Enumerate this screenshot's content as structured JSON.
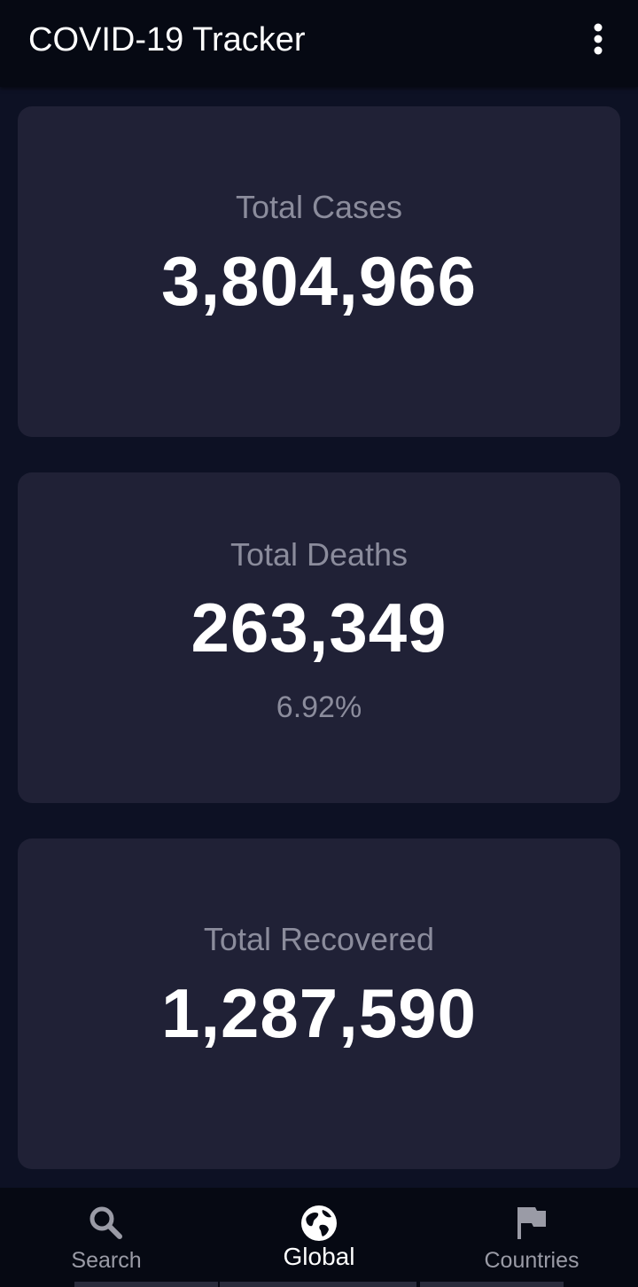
{
  "app_bar": {
    "title": "COVID-19 Tracker",
    "overflow_icon": "more-vert-icon"
  },
  "cards": [
    {
      "label": "Total Cases",
      "value": "3,804,966",
      "sub": ""
    },
    {
      "label": "Total Deaths",
      "value": "263,349",
      "sub": "6.92%"
    },
    {
      "label": "Total Recovered",
      "value": "1,287,590",
      "sub": ""
    }
  ],
  "bottom_nav": {
    "items": [
      {
        "label": "Search",
        "icon": "search-icon",
        "active": false
      },
      {
        "label": "Global",
        "icon": "globe-icon",
        "active": true
      },
      {
        "label": "Countries",
        "icon": "flag-icon",
        "active": false
      }
    ]
  },
  "colors": {
    "background": "#0d1124",
    "app_bar": "#060913",
    "card": "#202136",
    "label": "#8b8c9c",
    "value": "#ffffff"
  }
}
